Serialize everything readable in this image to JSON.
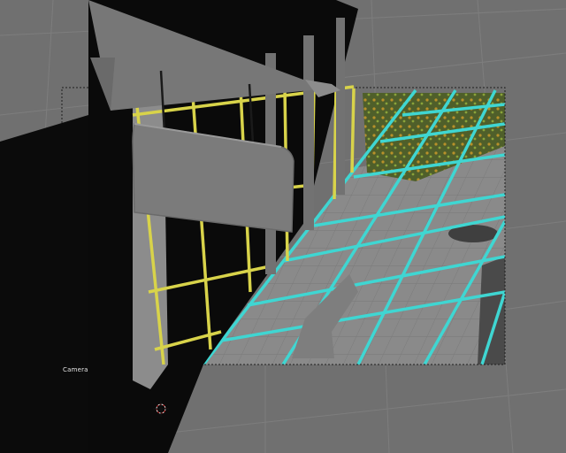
{
  "viewport": {
    "camera_label": "Camera"
  },
  "colors": {
    "background": "#707070",
    "ground_grid": "#7f7f7f",
    "floor_tile": "#8a8a8a",
    "cyan_grid": "#3fd6d2",
    "yellow_grid": "#d8d34a",
    "wall_dark": "#0a0a0a",
    "sign_grey": "#7b7b7b",
    "foliage": "#6d7a3a",
    "camera_border": "#1e1e1e"
  },
  "icons": {
    "cursor": "3d-cursor-icon",
    "camera_marker": "camera-frame-icon"
  }
}
